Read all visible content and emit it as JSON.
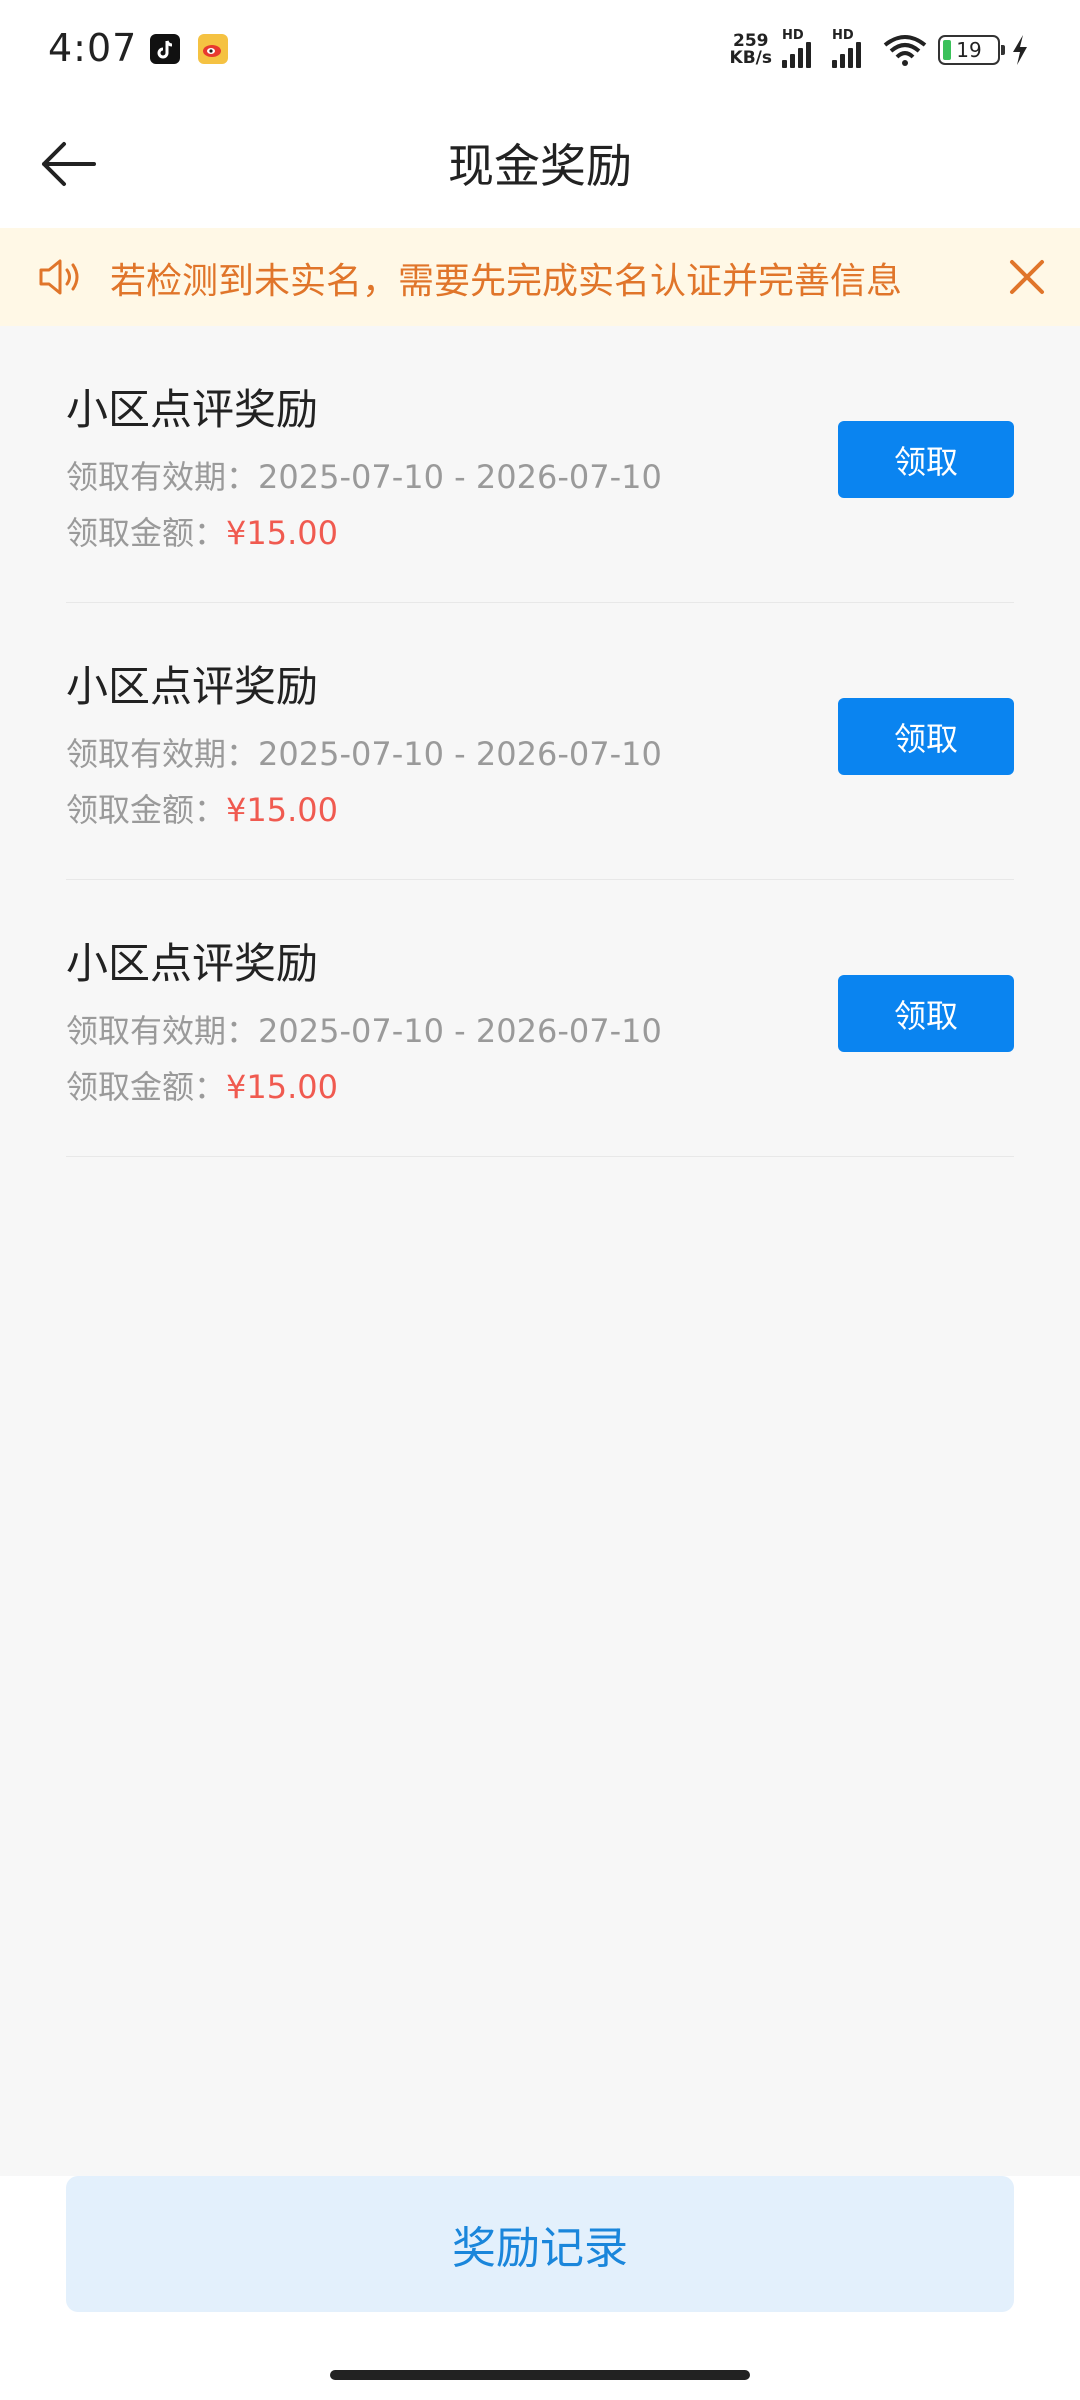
{
  "status_bar": {
    "time": "4:07",
    "net_speed_value": "259",
    "net_speed_unit": "KB/s",
    "sim1_label": "HD",
    "sim2_label": "HD",
    "battery_level": "19",
    "icons": [
      "tiktok-icon",
      "weibo-icon",
      "signal-icon",
      "wifi-icon",
      "battery-icon",
      "charging-icon"
    ]
  },
  "header": {
    "title": "现金奖励"
  },
  "notice": {
    "text": "若检测到未实名，需要先完成实名认证并完善信息"
  },
  "rewards": [
    {
      "title": "小区点评奖励",
      "period_label": "领取有效期：",
      "period": "2025-07-10 - 2026-07-10",
      "amount_label": "领取金额：",
      "amount": "¥15.00",
      "button": "领取"
    },
    {
      "title": "小区点评奖励",
      "period_label": "领取有效期：",
      "period": "2025-07-10 - 2026-07-10",
      "amount_label": "领取金额：",
      "amount": "¥15.00",
      "button": "领取"
    },
    {
      "title": "小区点评奖励",
      "period_label": "领取有效期：",
      "period": "2025-07-10 - 2026-07-10",
      "amount_label": "领取金额：",
      "amount": "¥15.00",
      "button": "领取"
    }
  ],
  "bottom": {
    "records_button": "奖励记录"
  },
  "colors": {
    "accent": "#0a84f0",
    "notice_text": "#e0752a",
    "notice_bg": "#fff8e6",
    "amount": "#f05a50",
    "records_bg": "#e3f0fc"
  }
}
